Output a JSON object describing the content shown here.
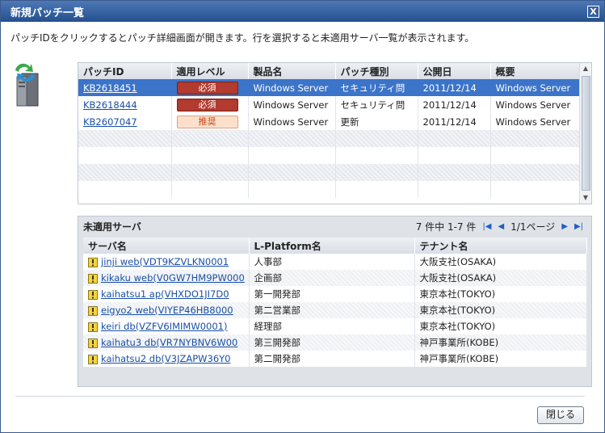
{
  "window": {
    "title": "新規パッチ一覧",
    "close_glyph": "X"
  },
  "description": "パッチIDをクリックするとパッチ詳細画面が開きます。行を選択すると未適用サーバ一覧が表示されます。",
  "patch_table": {
    "headers": [
      "パッチID",
      "適用レベル",
      "製品名",
      "パッチ種別",
      "公開日",
      "概要"
    ],
    "rows": [
      {
        "id": "KB2618451",
        "level": "必須",
        "level_type": "required",
        "product": "Windows Server",
        "kind": "セキュリティ問",
        "date": "2011/12/14",
        "summary": "Windows Server",
        "selected": true
      },
      {
        "id": "KB2618444",
        "level": "必須",
        "level_type": "required",
        "product": "Windows Server",
        "kind": "セキュリティ問",
        "date": "2011/12/14",
        "summary": "Windows Server",
        "selected": false
      },
      {
        "id": "KB2607047",
        "level": "推奨",
        "level_type": "recommended",
        "product": "Windows Server",
        "kind": "更新",
        "date": "2011/12/14",
        "summary": "Windows Server",
        "selected": false
      }
    ]
  },
  "server_panel": {
    "title": "未適用サーバ",
    "count_text": "7 件中 1-7 件",
    "page_text": "1/1ページ",
    "headers": [
      "サーバ名",
      "L-Platform名",
      "テナント名"
    ],
    "rows": [
      {
        "server": "jinji web(VDT9KZVLKN0001",
        "platform": "人事部",
        "tenant": "大阪支社(OSAKA)"
      },
      {
        "server": "kikaku web(V0GW7HM9PW000",
        "platform": "企画部",
        "tenant": "大阪支社(OSAKA)"
      },
      {
        "server": "kaihatsu1 ap(VHXDO1JI7D0",
        "platform": "第一開発部",
        "tenant": "東京本社(TOKYO)"
      },
      {
        "server": "eigyo2 web(VIYEP46HB8000",
        "platform": "第二営業部",
        "tenant": "東京本社(TOKYO)"
      },
      {
        "server": "keiri db(VZFV6IMIMW0001)",
        "platform": "経理部",
        "tenant": "東京本社(TOKYO)"
      },
      {
        "server": "kaihatu3 db(VR7NYBNV6W00",
        "platform": "第三開発部",
        "tenant": "神戸事業所(KOBE)"
      },
      {
        "server": "kaihatsu2 db(V3JZAPW36Y0",
        "platform": "第二開発部",
        "tenant": "神戸事業所(KOBE)"
      }
    ]
  },
  "footer": {
    "close_label": "閉じる"
  },
  "icons": {
    "server": "server-update-icon",
    "warning": "warning-icon",
    "first": "first-page-icon",
    "prev": "prev-page-icon",
    "next": "next-page-icon",
    "last": "last-page-icon"
  },
  "colors": {
    "titlebar": "#24508f",
    "selected_row": "#3b74c8",
    "required_badge": "#b23a2e",
    "recommended_badge": "#fde0cc",
    "link": "#1a4fa3"
  }
}
